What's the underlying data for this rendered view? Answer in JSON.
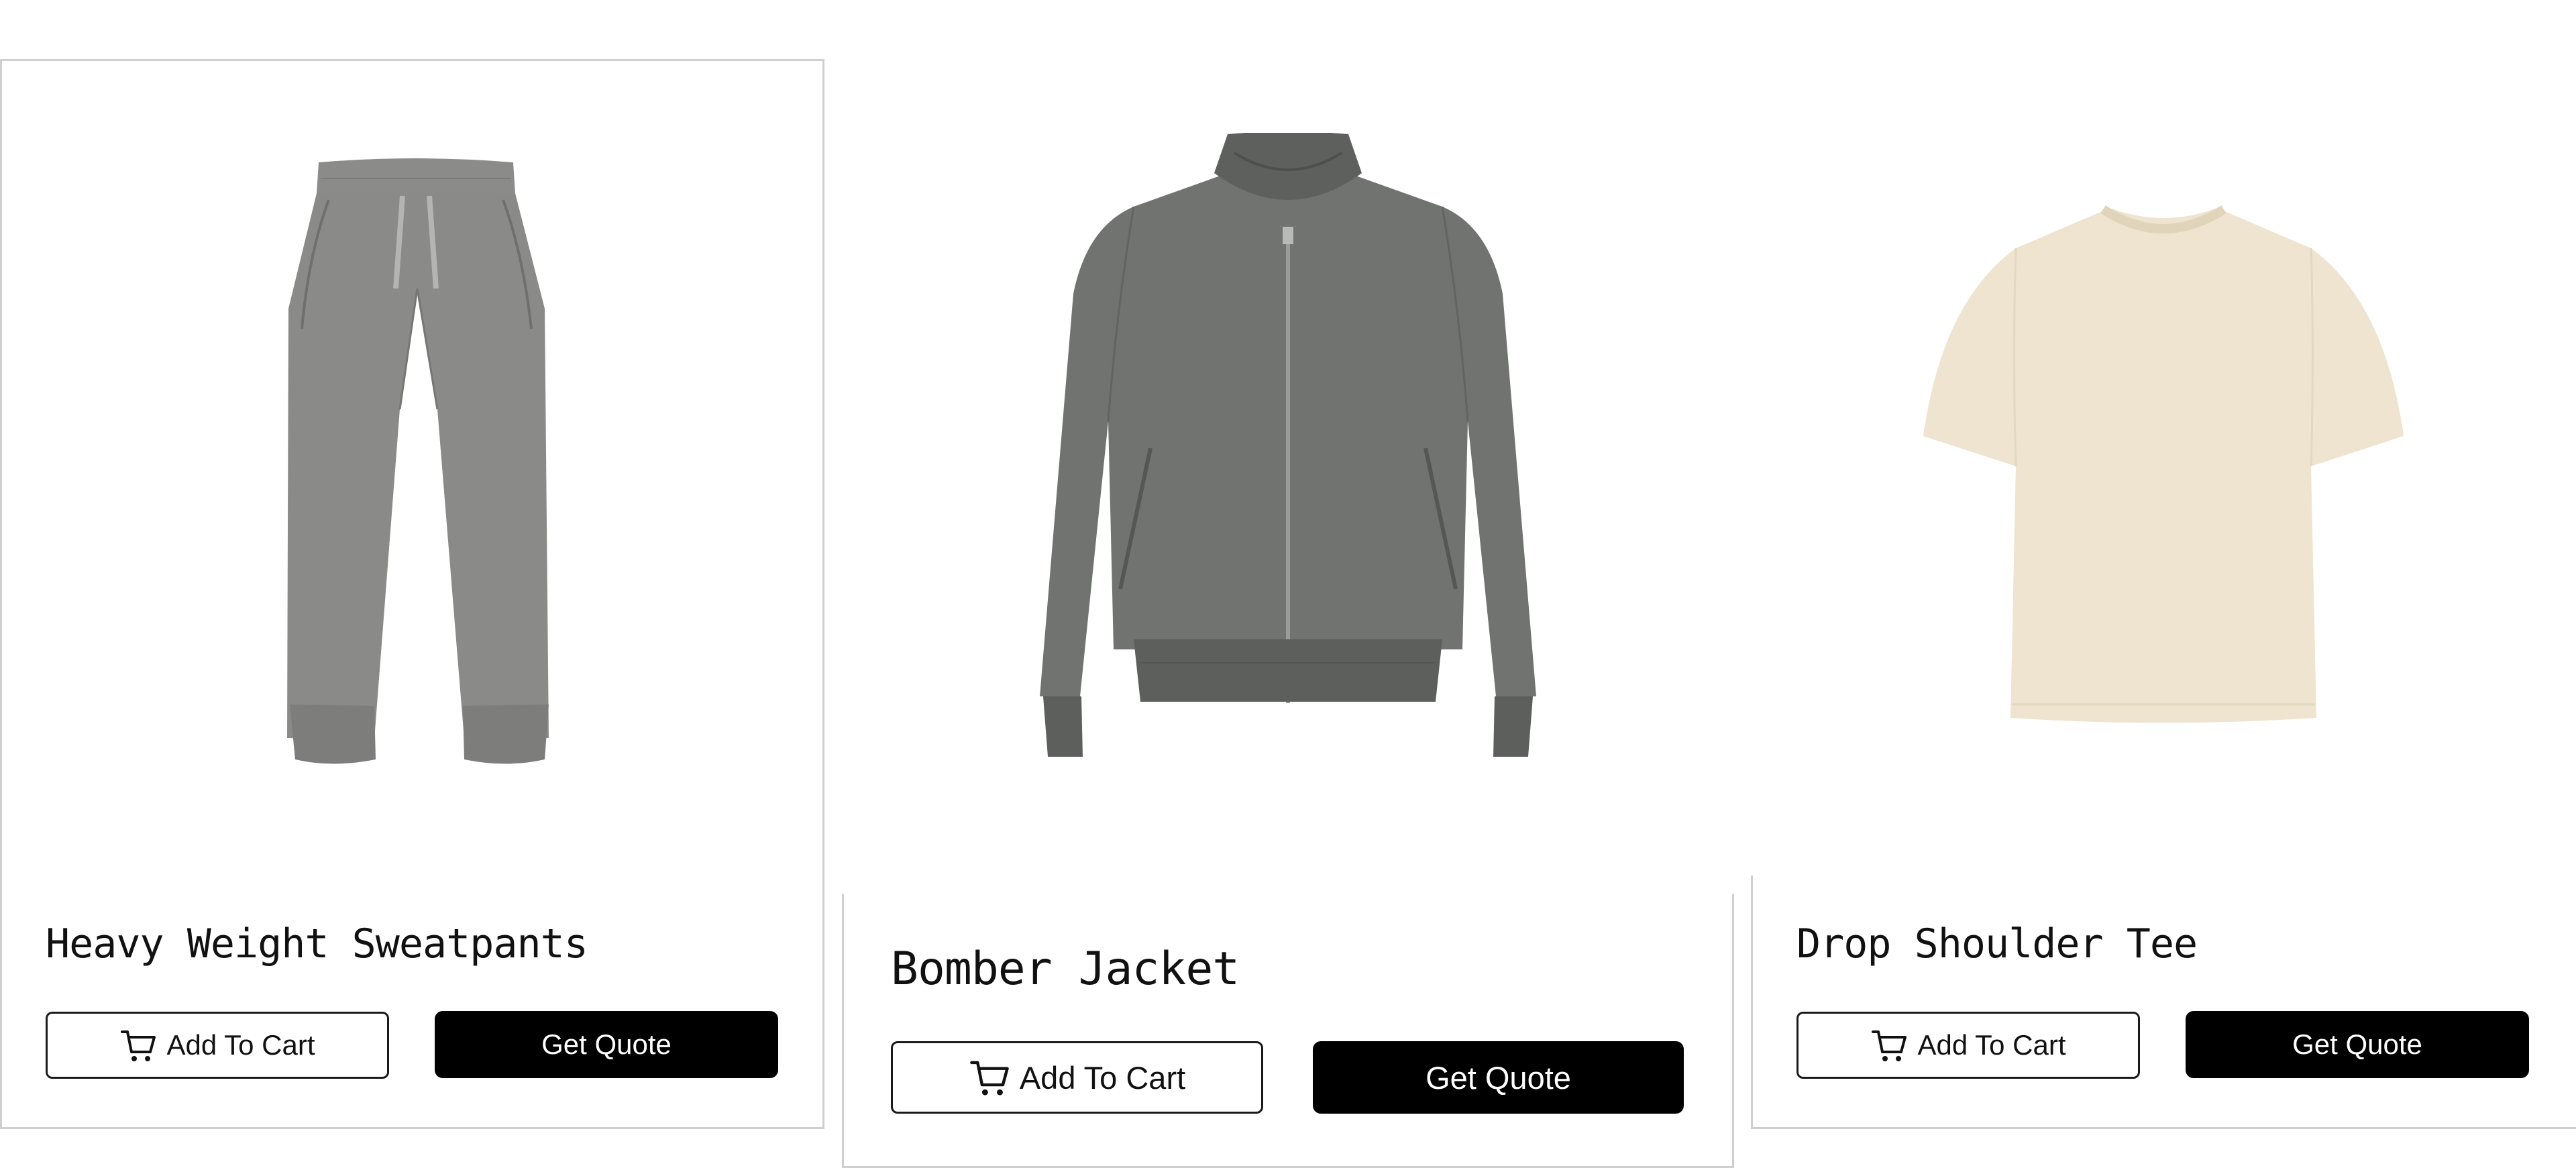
{
  "products": [
    {
      "name": "Heavy Weight Sweatpants",
      "image": "sweatpants-image",
      "color": "#8a8b89",
      "add_to_cart_label": "Add To Cart",
      "get_quote_label": "Get Quote"
    },
    {
      "name": "Bomber Jacket",
      "image": "bomber-jacket-image",
      "color": "#6f716e",
      "add_to_cart_label": "Add To Cart",
      "get_quote_label": "Get Quote"
    },
    {
      "name": "Drop Shoulder Tee",
      "image": "tshirt-image",
      "color": "#eee4cf",
      "add_to_cart_label": "Add To Cart",
      "get_quote_label": "Get Quote"
    }
  ],
  "icons": {
    "cart": "cart-icon"
  },
  "colors": {
    "button_primary": "#000000",
    "button_primary_text": "#ffffff",
    "button_outline_border": "#1a1a1a",
    "card_border": "#cfcfcf"
  }
}
